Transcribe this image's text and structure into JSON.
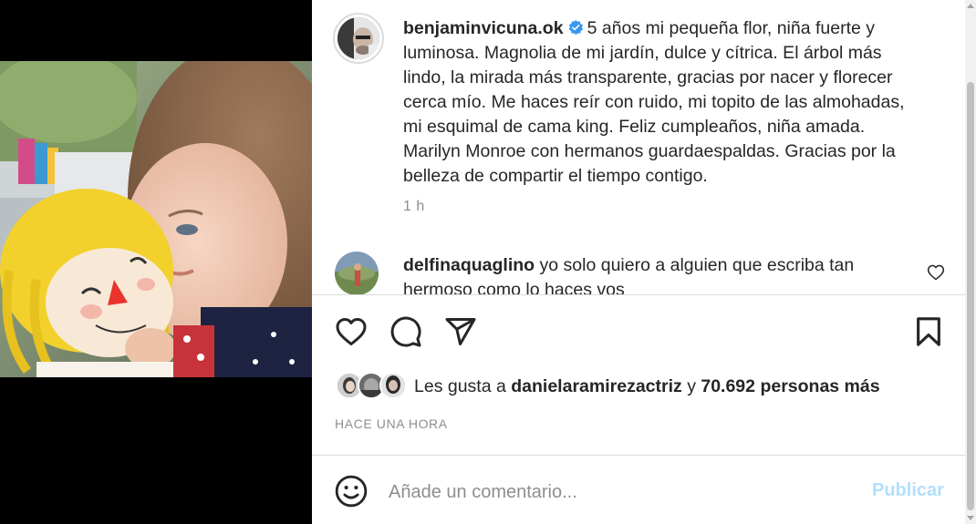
{
  "post": {
    "author": "benjaminvicuna.ok",
    "verified": true,
    "caption": "5 años mi pequeña flor, niña fuerte y luminosa. Magnolia de mi jardín, dulce y cítrica. El árbol más lindo, la mirada más transparente, gracias por nacer y florecer cerca mío. Me haces reír con ruido, mi topito de las almohadas, mi esquimal de cama king. Feliz cumpleaños, niña amada. Marilyn Monroe con hermanos guardaespaldas. Gracias por la belleza de compartir el tiempo contigo.",
    "time_ago": "1 h"
  },
  "comments": [
    {
      "username": "delfinaquaglino",
      "text": "yo solo quiero a alguien que escriba tan hermoso como lo haces vos"
    }
  ],
  "actions": {
    "like_icon": "heart-icon",
    "comment_icon": "comment-icon",
    "share_icon": "paper-plane-icon",
    "save_icon": "bookmark-icon"
  },
  "likes": {
    "prefix": "Les gusta a",
    "user": "danielaramirezactriz",
    "connector": "y",
    "count": "70.692",
    "suffix": "personas más"
  },
  "timestamp": "HACE UNA HORA",
  "composer": {
    "placeholder": "Añade un comentario...",
    "publish_label": "Publicar",
    "emoji_icon": "smiley-icon"
  },
  "colors": {
    "verified": "#3897f0",
    "publish_disabled": "#b2dffc",
    "muted_text": "#8e8e8e",
    "divider": "#dbdbdb"
  }
}
